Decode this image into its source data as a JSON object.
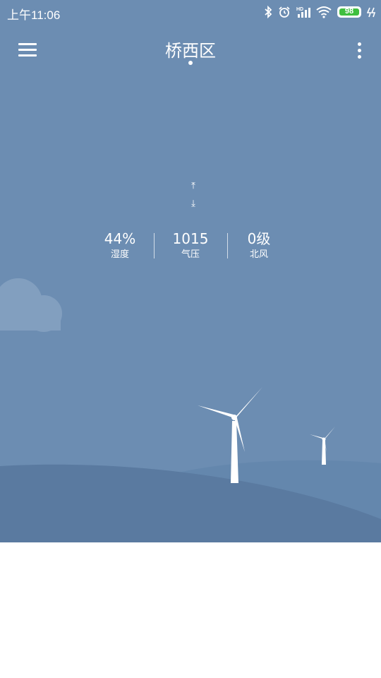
{
  "status_bar": {
    "time": "上午11:06",
    "icons": [
      "bluetooth-icon",
      "alarm-icon",
      "hd-signal-icon",
      "wifi-icon",
      "battery-icon",
      "charging-icon"
    ],
    "battery_level": "98"
  },
  "header": {
    "city": "桥西区",
    "menu_icon": "hamburger-menu-icon",
    "more_icon": "more-vertical-icon"
  },
  "temperature_range": {
    "high_icon": "arrow-up-bar-icon",
    "low_icon": "arrow-down-bar-icon",
    "high_glyph": "⤒",
    "low_glyph": "⤓"
  },
  "stats": [
    {
      "value": "44%",
      "label": "湿度"
    },
    {
      "value": "1015",
      "label": "气压"
    },
    {
      "value": "0级",
      "label": "北风"
    }
  ],
  "colors": {
    "sky": "#6c8db2",
    "hill_back": "#6487ad",
    "hill_front": "#5a7aa0",
    "battery": "#3fbf3f"
  }
}
